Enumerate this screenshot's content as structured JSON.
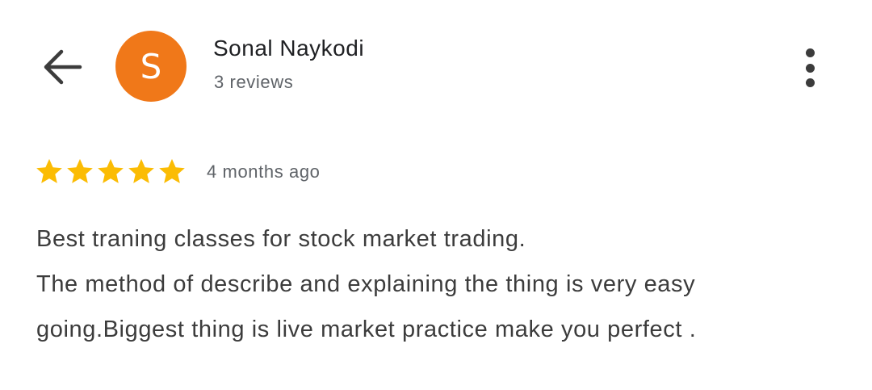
{
  "header": {
    "back_icon": "arrow-left-icon",
    "avatar_letter": "S",
    "avatar_color": "#f07819",
    "user_name": "Sonal Naykodi",
    "review_count": "3 reviews",
    "more_icon": "more-vertical-icon"
  },
  "review": {
    "rating": 5,
    "rating_max": 5,
    "star_color": "#fbbc04",
    "time_ago": "4 months ago",
    "text_lines": [
      "Best traning classes for stock market trading.",
      "The method of describe and explaining the thing is very easy",
      "going.Biggest thing is live market practice make you perfect ."
    ]
  }
}
